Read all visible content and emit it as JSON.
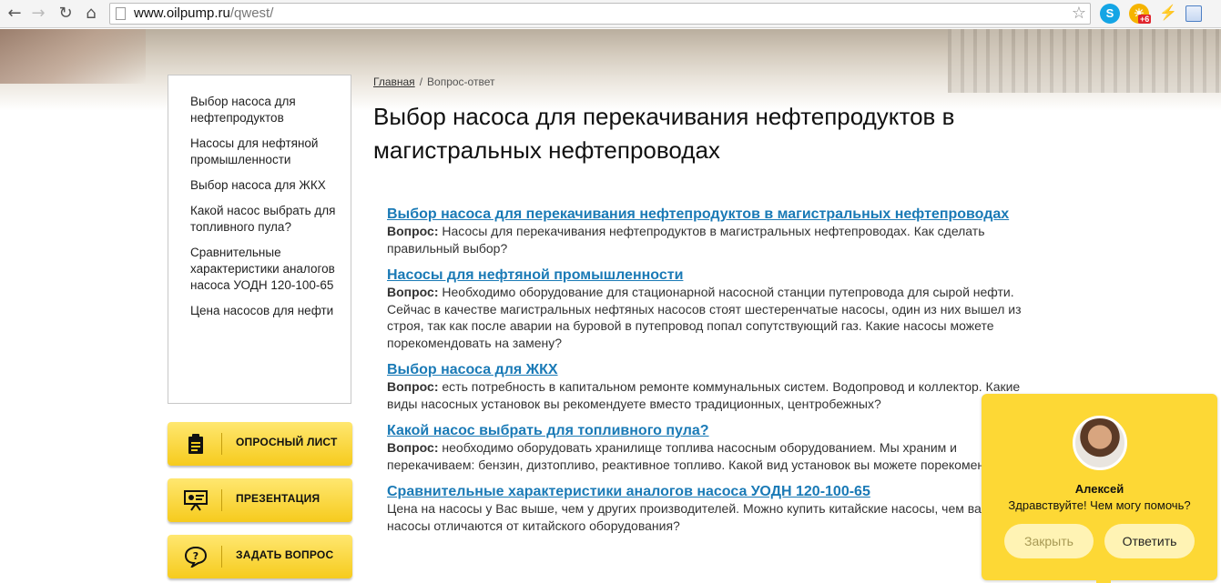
{
  "browser": {
    "url_host": "www.oilpump.ru",
    "url_path": "/qwest/",
    "weather_badge": "+6"
  },
  "sidebar": {
    "items": [
      {
        "label": "Выбор насоса для нефтепродуктов"
      },
      {
        "label": "Насосы для нефтяной промышленности"
      },
      {
        "label": "Выбор насоса для ЖКХ"
      },
      {
        "label": "Какой насос выбрать для топливного пула?"
      },
      {
        "label": "Сравнительные характеристики аналогов насоса УОДН 120-100-65"
      },
      {
        "label": "Цена насосов для нефти"
      }
    ]
  },
  "actions": [
    {
      "label": "ОПРОСНЫЙ ЛИСТ",
      "icon": "clipboard-icon"
    },
    {
      "label": "ПРЕЗЕНТАЦИЯ",
      "icon": "presentation-icon"
    },
    {
      "label": "ЗАДАТЬ ВОПРОС",
      "icon": "question-bubble-icon"
    }
  ],
  "breadcrumb": {
    "home": "Главная",
    "separator": "/",
    "current": "Вопрос-ответ"
  },
  "page": {
    "title": "Выбор насоса для перекачивания нефтепродуктов в магистральных нефтепроводах"
  },
  "questions": [
    {
      "title": "Выбор насоса для перекачивания нефтепродуктов в магистральных нефтепроводах",
      "prefix": "Вопрос:",
      "text": " Насосы для перекачивания нефтепродуктов в магистральных нефтепроводах. Как сделать правильный выбор?"
    },
    {
      "title": "Насосы для нефтяной промышленности",
      "prefix": "Вопрос:",
      "text": " Необходимо оборудование для стационарной насосной станции путепровода для сырой нефти. Сейчас в качестве магистральных нефтяных насосов стоят шестеренчатые насосы, один из них вышел из строя, так как после аварии на буровой в путепровод попал сопутствующий газ. Какие насосы можете порекомендовать на замену?"
    },
    {
      "title": "Выбор насоса для ЖКХ",
      "prefix": "Вопрос:",
      "text": " есть потребность в капитальном ремонте коммунальных систем. Водопровод и коллектор. Какие виды насосных установок вы рекомендуете вместо традиционных, центробежных?"
    },
    {
      "title": "Какой насос выбрать для топливного пула?",
      "prefix": "Вопрос:",
      "text": " необходимо оборудовать хранилище топлива насосным оборудованием. Мы храним и перекачиваем: бензин, дизтопливо, реактивное топливо. Какой вид установок вы можете порекомендовать?"
    },
    {
      "title": "Сравнительные характеристики аналогов насоса УОДН 120-100-65",
      "prefix": "",
      "text": "Цена на насосы у Вас выше, чем у других производителей. Можно купить китайские насосы, чем ваши насосы отличаются от китайского оборудования?"
    }
  ],
  "chat": {
    "name": "Алексей",
    "message": "Здравствуйте! Чем могу помочь?",
    "close_label": "Закрыть",
    "reply_label": "Ответить"
  },
  "colors": {
    "link": "#1a7ab6",
    "accent_yellow": "#fdd835"
  }
}
